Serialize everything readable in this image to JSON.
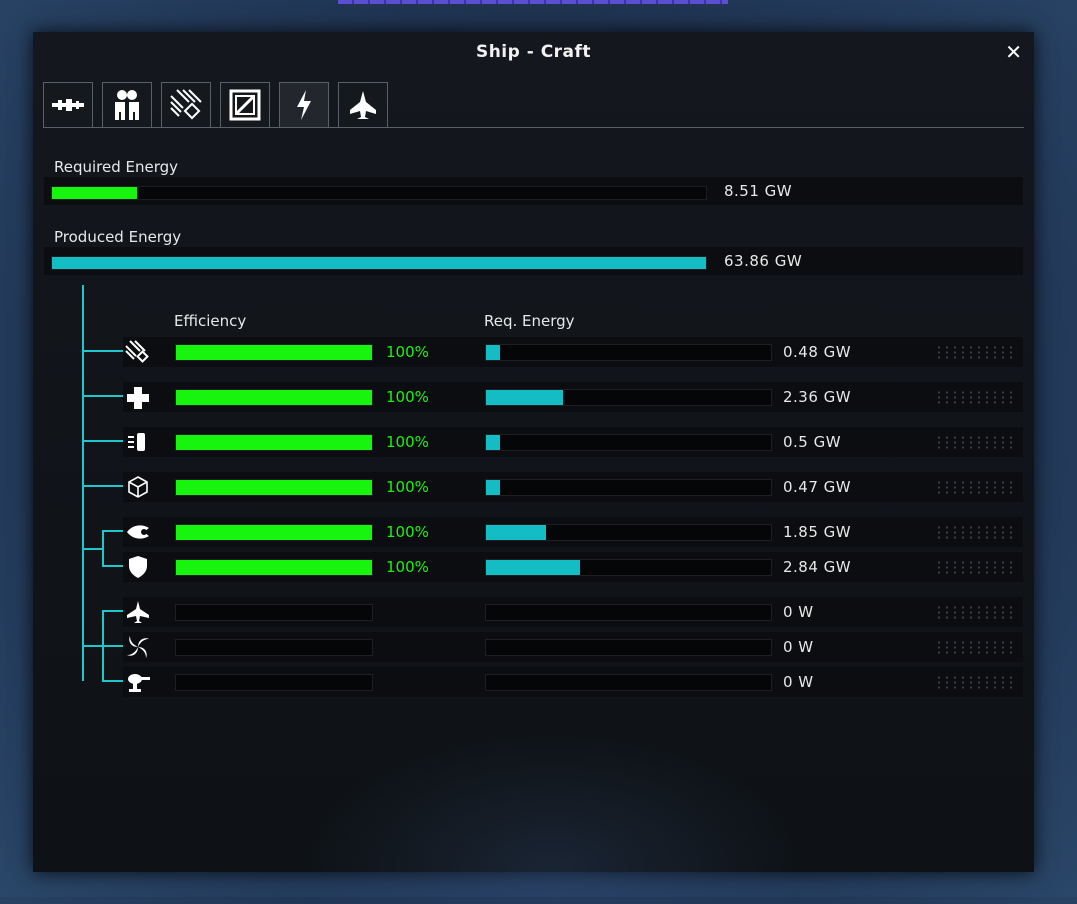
{
  "window": {
    "title": "Ship - Craft",
    "close_glyph": "✕"
  },
  "tabs": [
    {
      "icon": "weapon-icon",
      "active": false
    },
    {
      "icon": "crew-icon",
      "active": false
    },
    {
      "icon": "circuit-icon",
      "active": false
    },
    {
      "icon": "cargo-crate-icon",
      "active": false
    },
    {
      "icon": "lightning-icon",
      "active": true
    },
    {
      "icon": "fighter-ship-icon",
      "active": false
    }
  ],
  "required_energy": {
    "label": "Required Energy",
    "value": "8.51 GW",
    "fraction": 0.13,
    "color": "#17f50f"
  },
  "produced_energy": {
    "label": "Produced Energy",
    "value": "63.86 GW",
    "fraction": 1.0,
    "color": "#14bcc4"
  },
  "columns": {
    "efficiency": "Efficiency",
    "req_energy": "Req. Energy"
  },
  "modules": [
    {
      "icon": "circuit-icon",
      "efficiency": "100%",
      "eff_fraction": 1.0,
      "req_value": "0.48 GW",
      "req_fraction": 0.05
    },
    {
      "icon": "medical-cross-icon",
      "efficiency": "100%",
      "eff_fraction": 1.0,
      "req_value": "2.36 GW",
      "req_fraction": 0.27
    },
    {
      "icon": "thruster-icon",
      "efficiency": "100%",
      "eff_fraction": 1.0,
      "req_value": "0.5 GW",
      "req_fraction": 0.05
    },
    {
      "icon": "cube-icon",
      "efficiency": "100%",
      "eff_fraction": 1.0,
      "req_value": "0.47 GW",
      "req_fraction": 0.05
    },
    {
      "icon": "engine-flame-icon",
      "efficiency": "100%",
      "eff_fraction": 1.0,
      "req_value": "1.85 GW",
      "req_fraction": 0.21
    },
    {
      "icon": "shield-icon",
      "efficiency": "100%",
      "eff_fraction": 1.0,
      "req_value": "2.84 GW",
      "req_fraction": 0.33
    },
    {
      "icon": "fighter-ship-icon",
      "efficiency": "",
      "eff_fraction": 0,
      "req_value": "0 W",
      "req_fraction": 0
    },
    {
      "icon": "vortex-icon",
      "efficiency": "",
      "eff_fraction": 0,
      "req_value": "0 W",
      "req_fraction": 0
    },
    {
      "icon": "turret-icon",
      "efficiency": "",
      "eff_fraction": 0,
      "req_value": "0 W",
      "req_fraction": 0
    }
  ]
}
